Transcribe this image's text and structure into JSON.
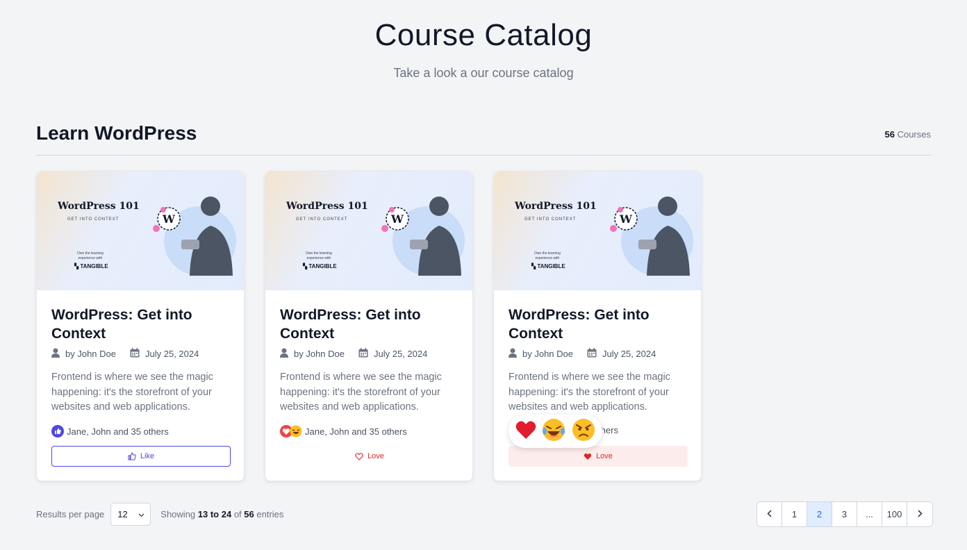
{
  "header": {
    "title": "Course Catalog",
    "subtitle": "Take a look a our course catalog"
  },
  "section": {
    "title": "Learn WordPress",
    "count": "56",
    "count_label": "Courses"
  },
  "thumbnail": {
    "title": "WordPress 101",
    "subtitle": "GET INTO CONTEXT",
    "own_line1": "Own the learning",
    "own_line2": "experience with",
    "brand": "TANGIBLE"
  },
  "cards": [
    {
      "title": "WordPress: Get into Context",
      "author": "by John Doe",
      "date": "July 25, 2024",
      "description": "Frontend is where we see the magic happening: it's the storefront of your websites and web applications.",
      "reactions_text": "Jane, John and 35 others",
      "button_label": "Like"
    },
    {
      "title": "WordPress: Get into Context",
      "author": "by John Doe",
      "date": "July 25, 2024",
      "description": "Frontend is where we see the magic happening: it's the storefront of your websites and web applications.",
      "reactions_text": "Jane, John and 35 others",
      "button_label": "Love"
    },
    {
      "title": "WordPress: Get into Context",
      "author": "by John Doe",
      "date": "July 25, 2024",
      "description": "Frontend is where we see the magic happening: it's the storefront of your websites and web applications.",
      "reactions_text": "6 others",
      "button_label": "Love"
    }
  ],
  "footer": {
    "results_label": "Results per page",
    "per_page": "12",
    "showing_prefix": "Showing",
    "range": "13 to 24",
    "of": "of",
    "total": "56",
    "entries": "entries"
  },
  "pagination": {
    "pages": [
      "1",
      "2",
      "3",
      "...",
      "100"
    ],
    "active": "2"
  },
  "colors": {
    "accent": "#4f46e5",
    "love": "#dc2626",
    "active_page_bg": "#e0ecff"
  }
}
